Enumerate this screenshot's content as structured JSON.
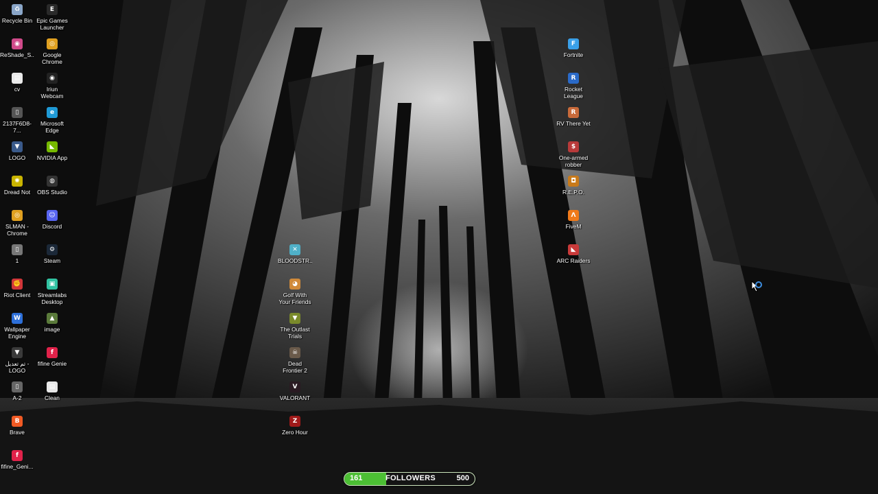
{
  "desktop": {
    "icons_col1": [
      {
        "label": "Recycle Bin",
        "icon": "recycle-bin-icon",
        "color": "#8aa6c8",
        "glyph": "♻"
      },
      {
        "label": "ReShade_S...",
        "icon": "reshade-icon",
        "color": "#d04a8a",
        "glyph": "◉"
      },
      {
        "label": "cv",
        "icon": "document-icon",
        "color": "#e9e9e9",
        "glyph": "▤"
      },
      {
        "label": "2137F6D8-7...",
        "icon": "file-icon",
        "color": "#555555",
        "glyph": "▯"
      },
      {
        "label": "LOGO",
        "icon": "logo-icon",
        "color": "#3a5a8a",
        "glyph": "▼"
      },
      {
        "label": "Dread Not",
        "icon": "dread-not-icon",
        "color": "#c9b400",
        "glyph": "✺"
      },
      {
        "label": "SLMAN - Chrome",
        "icon": "chrome-icon",
        "color": "#e0a020",
        "glyph": "◎"
      },
      {
        "label": "1",
        "icon": "file-icon",
        "color": "#777777",
        "glyph": "▯"
      },
      {
        "label": "Riot Client",
        "icon": "riot-client-icon",
        "color": "#d13639",
        "glyph": "✊"
      },
      {
        "label": "Wallpaper Engine",
        "icon": "wallpaper-engine-icon",
        "color": "#2d6fd8",
        "glyph": "W"
      },
      {
        "label": "تم تعديل - LOGO",
        "icon": "logo-icon",
        "color": "#3a3a3a",
        "glyph": "▼"
      },
      {
        "label": "A-2",
        "icon": "file-icon",
        "color": "#666666",
        "glyph": "▯"
      },
      {
        "label": "Brave",
        "icon": "brave-icon",
        "color": "#f05a24",
        "glyph": "B"
      },
      {
        "label": "fifine_Geni...",
        "icon": "fifine-icon",
        "color": "#e0224a",
        "glyph": "f"
      }
    ],
    "icons_col2": [
      {
        "label": "Epic Games Launcher",
        "icon": "epic-games-icon",
        "color": "#2a2a2a",
        "glyph": "E"
      },
      {
        "label": "Google Chrome",
        "icon": "chrome-icon",
        "color": "#e0a020",
        "glyph": "◎"
      },
      {
        "label": "Iriun Webcam",
        "icon": "webcam-icon",
        "color": "#222222",
        "glyph": "◉"
      },
      {
        "label": "Microsoft Edge",
        "icon": "edge-icon",
        "color": "#1f9ad6",
        "glyph": "e"
      },
      {
        "label": "NVIDIA App",
        "icon": "nvidia-icon",
        "color": "#76b900",
        "glyph": "◣"
      },
      {
        "label": "OBS Studio",
        "icon": "obs-icon",
        "color": "#333333",
        "glyph": "◍"
      },
      {
        "label": "Discord",
        "icon": "discord-icon",
        "color": "#5865f2",
        "glyph": "☺"
      },
      {
        "label": "Steam",
        "icon": "steam-icon",
        "color": "#1b2838",
        "glyph": "⚙"
      },
      {
        "label": "Streamlabs Desktop",
        "icon": "streamlabs-icon",
        "color": "#31c3a2",
        "glyph": "▣"
      },
      {
        "label": "image",
        "icon": "image-icon",
        "color": "#5a7a3a",
        "glyph": "▲"
      },
      {
        "label": "fifine Genie",
        "icon": "fifine-icon",
        "color": "#e0224a",
        "glyph": "f"
      },
      {
        "label": "Clean",
        "icon": "file-icon",
        "color": "#e8e8e8",
        "glyph": "▤"
      }
    ],
    "icons_col3": [
      {
        "label": "BLOODSTR...",
        "icon": "bloodstrike-icon",
        "color": "#4fb0c8",
        "glyph": "✕"
      },
      {
        "label": "Golf With Your Friends",
        "icon": "golf-icon",
        "color": "#d08a3a",
        "glyph": "◕"
      },
      {
        "label": "The Outlast Trials",
        "icon": "outlast-icon",
        "color": "#7a8a2a",
        "glyph": "▼"
      },
      {
        "label": "Dead Frontier 2",
        "icon": "dead-frontier-icon",
        "color": "#6a5a4a",
        "glyph": "☠"
      },
      {
        "label": "VALORANT",
        "icon": "valorant-icon",
        "color": "#2a1a22",
        "glyph": "V"
      },
      {
        "label": "Zero Hour",
        "icon": "zero-hour-icon",
        "color": "#a01a1a",
        "glyph": "Z"
      }
    ],
    "icons_col4": [
      {
        "label": "Fortnite",
        "icon": "fortnite-icon",
        "color": "#3aa0e8",
        "glyph": "F"
      },
      {
        "label": "Rocket League",
        "icon": "rocket-league-icon",
        "color": "#2a6ac8",
        "glyph": "R"
      },
      {
        "label": "RV There Yet",
        "icon": "rv-there-yet-icon",
        "color": "#c86a3a",
        "glyph": "R"
      },
      {
        "label": "One-armed robber",
        "icon": "one-armed-robber-icon",
        "color": "#b83a3a",
        "glyph": "$"
      },
      {
        "label": "R.E.P.O.",
        "icon": "repo-icon",
        "color": "#c87a1a",
        "glyph": "◘"
      },
      {
        "label": "FiveM",
        "icon": "fivem-icon",
        "color": "#f07a1a",
        "glyph": "Λ"
      },
      {
        "label": "ARC Raiders",
        "icon": "arc-raiders-icon",
        "color": "#c83a3a",
        "glyph": "◣"
      }
    ]
  },
  "follower_goal": {
    "current": "161",
    "title": "FOLLOWERS",
    "goal": "500",
    "progress_fraction": 0.322,
    "fill_color": "#4cbf34"
  }
}
